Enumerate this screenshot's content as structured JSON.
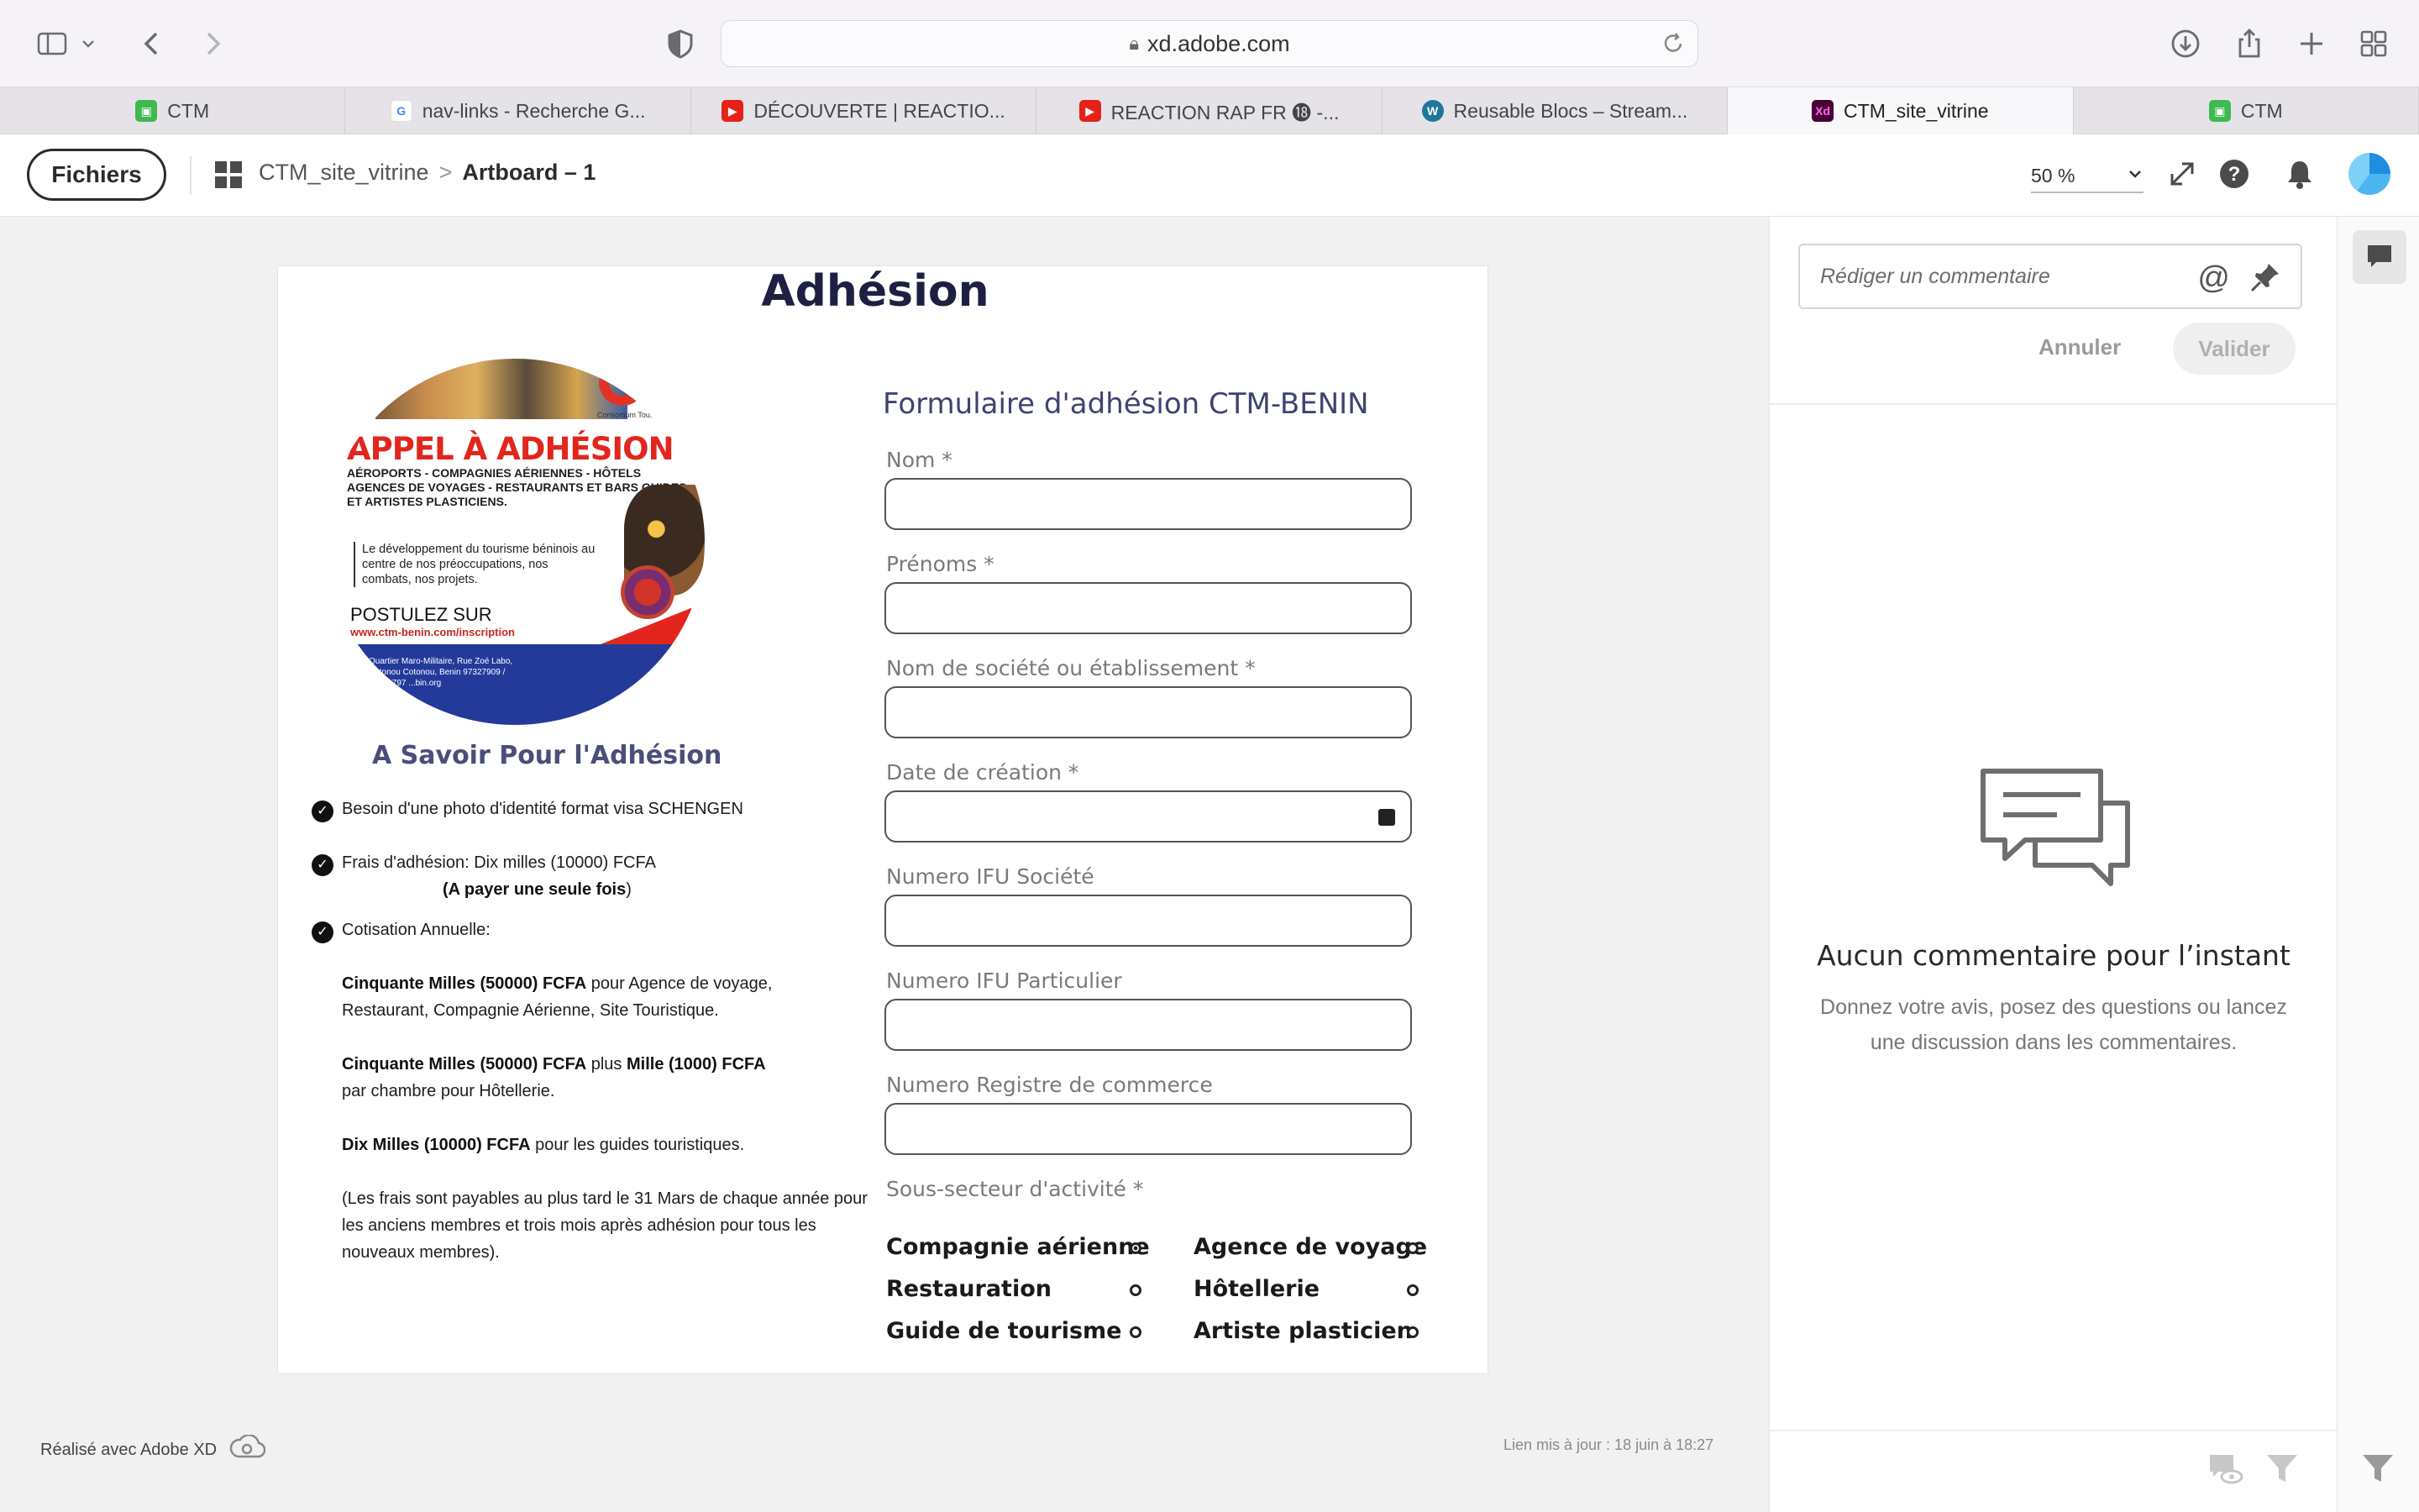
{
  "browser": {
    "url": "xd.adobe.com",
    "tabs": [
      {
        "label": "CTM",
        "icon": "green-shop-favicon",
        "color": "#3fb950"
      },
      {
        "label": "nav-links - Recherche G...",
        "icon": "google-favicon",
        "color": "#4285f4"
      },
      {
        "label": "DÉCOUVERTE | REACTIO...",
        "icon": "youtube-favicon",
        "color": "#e62117"
      },
      {
        "label": "REACTION RAP FR ⓲ -...",
        "icon": "youtube-favicon",
        "color": "#e62117"
      },
      {
        "label": "Reusable Blocs – Stream...",
        "icon": "wordpress-favicon",
        "color": "#21759b"
      },
      {
        "label": "CTM_site_vitrine",
        "icon": "adobe-xd-favicon",
        "color": "#470137",
        "active": true
      },
      {
        "label": "CTM",
        "icon": "green-shop-favicon",
        "color": "#3fb950"
      }
    ]
  },
  "xd": {
    "files_label": "Fichiers",
    "breadcrumb_project": "CTM_site_vitrine",
    "breadcrumb_sep": ">",
    "breadcrumb_current": "Artboard – 1",
    "zoom": "50 %"
  },
  "artboard": {
    "title": "Adhésion",
    "poster": {
      "brand_sub": "Consortium Tou.",
      "headline": "APPEL À ADHÉSION",
      "sectors": "AÉROPORTS - COMPAGNIES AÉRIENNES - HÔTELS AGENCES DE VOYAGES - RESTAURANTS ET BARS GUIDES ET ARTISTES PLASTICIENS.",
      "quote": "Le développement du tourisme béninois au centre de nos préoccupations, nos combats, nos projets.",
      "postulez": "POSTULEZ SUR",
      "url": "www.ctm-benin.com/inscription",
      "address": "Quartier Maro-Militaire, Rue Zoé Labo, Cotonou Cotonou, Benin 97327909 / 65979797 ...bin.org"
    },
    "savoir_title": "A Savoir Pour l'Adhésion",
    "items": {
      "photo": "Besoin d'une photo d'identité format visa SCHENGEN",
      "frais": "Frais d'adhésion: Dix milles (10000) FCFA",
      "frais_note_bold": "(A payer une seule fois",
      "frais_note_end": ")",
      "cotisation": "Cotisation Annuelle:",
      "c1_bold": "Cinquante Milles (50000) FCFA",
      "c1_rest": " pour Agence de voyage, Restaurant, Compagnie Aérienne, Site Touristique.",
      "c2_bold": "Cinquante Milles (50000) FCFA",
      "c2_mid": " plus ",
      "c2_bold2": "Mille (1000) FCFA",
      "c2_rest": "par chambre pour Hôtellerie.",
      "c3_bold": "Dix Milles (10000) FCFA",
      "c3_rest": " pour les guides touristiques.",
      "note": "(Les frais sont payables au plus tard le 31 Mars de chaque année pour les anciens membres et trois mois après adhésion pour tous les nouveaux membres)."
    },
    "form": {
      "title": "Formulaire d'adhésion CTM-BENIN",
      "fields": [
        {
          "label": "Nom *",
          "value": ""
        },
        {
          "label": "Prénoms *",
          "value": ""
        },
        {
          "label": "Nom de société ou établissement *",
          "value": ""
        },
        {
          "label": "Date de création *",
          "value": ""
        },
        {
          "label": "Numero IFU Société",
          "value": ""
        },
        {
          "label": "Numero IFU Particulier",
          "value": ""
        },
        {
          "label": "Numero Registre de commerce",
          "value": ""
        }
      ],
      "subsector_label": "Sous-secteur d'activité *",
      "options": [
        {
          "label": "Compagnie aérienne",
          "selected": true
        },
        {
          "label": "Agence de voyage",
          "selected": false
        },
        {
          "label": "Restauration",
          "selected": false
        },
        {
          "label": "Hôtellerie",
          "selected": false
        },
        {
          "label": "Guide de tourisme",
          "selected": false
        },
        {
          "label": "Artiste plasticien",
          "selected": false
        }
      ]
    }
  },
  "footer": {
    "made_with": "Réalisé avec Adobe XD",
    "updated": "Lien mis à jour : 18 juin à 18:27"
  },
  "comments": {
    "placeholder": "Rédiger un commentaire",
    "mention_symbol": "@",
    "cancel": "Annuler",
    "submit": "Valider",
    "empty_title": "Aucun commentaire pour l’instant",
    "empty_sub": "Donnez votre avis, posez des questions ou lancez une discussion dans les commentaires."
  }
}
